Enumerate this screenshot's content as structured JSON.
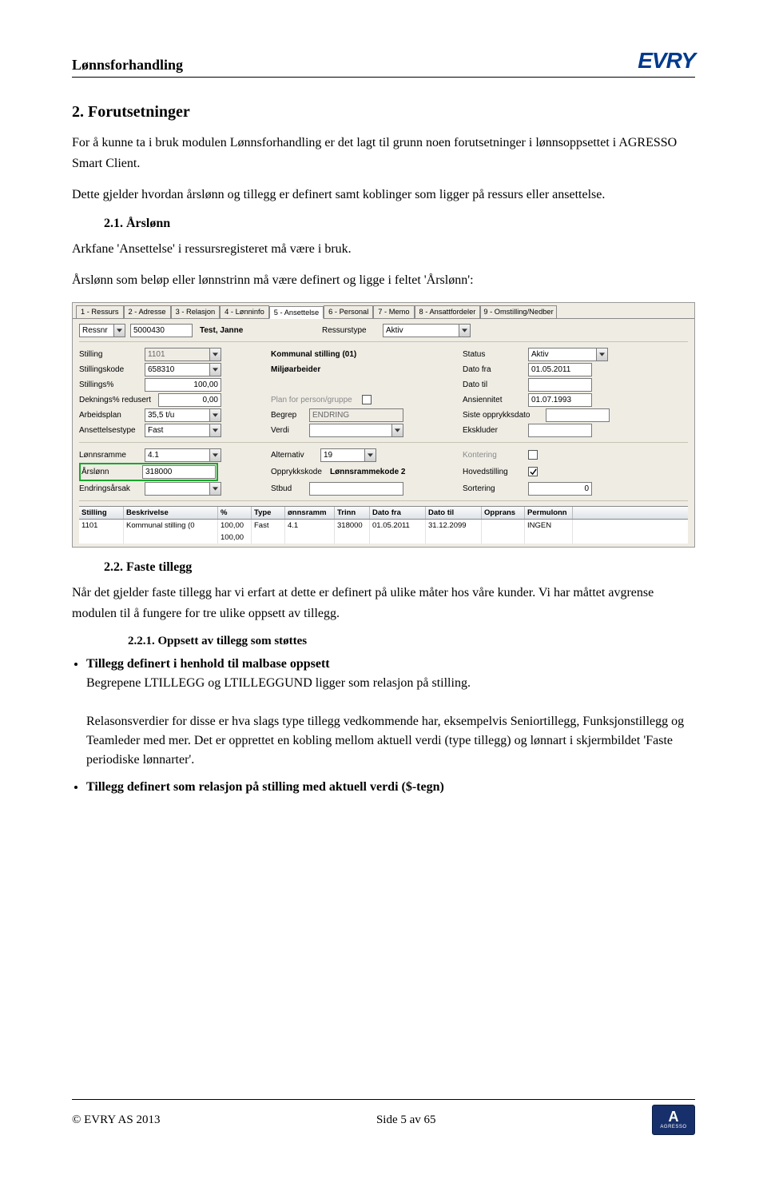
{
  "header": {
    "title": "Lønnsforhandling",
    "logo_text": "EVRY"
  },
  "section2": {
    "heading": "2. Forutsetninger",
    "p1": "For å kunne ta i bruk modulen Lønnsforhandling er det lagt til grunn noen forutsetninger i lønnsoppsettet i AGRESSO Smart Client.",
    "p2": "Dette gjelder hvordan årslønn og tillegg er definert samt koblinger som ligger på ressurs eller ansettelse."
  },
  "s21": {
    "heading": "2.1. Årslønn",
    "p1": "Arkfane 'Ansettelse' i ressursregisteret må være i bruk.",
    "p2": "Årslønn som beløp eller lønnstrinn må være definert og ligge i feltet 'Årslønn':"
  },
  "shot": {
    "tabs": [
      "1 - Ressurs",
      "2 - Adresse",
      "3 - Relasjon",
      "4 - Lønninfo",
      "5 - Ansettelse",
      "6 - Personal",
      "7 - Memo",
      "8 - Ansattfordeler",
      "9 - Omstilling/Nedber"
    ],
    "active_tab_index": 4,
    "row0": {
      "ressnr_label": "Ressnr",
      "ressnr": "5000430",
      "name": "Test, Janne",
      "ressurstype_label": "Ressurstype",
      "ressurstype": "Aktiv"
    },
    "labels_left": {
      "stilling": "Stilling",
      "stillingskode": "Stillingskode",
      "stillingspct": "Stillings%",
      "deknings": "Deknings% redusert",
      "arbeidsplan": "Arbeidsplan",
      "ansettelsestype": "Ansettelsestype",
      "lonnsramme": "Lønnsramme",
      "arslonn": "Årslønn",
      "endringsarsak": "Endringsårsak"
    },
    "labels_mid": {
      "kommunal": "Kommunal stilling (01)",
      "miljo": "Miljøarbeider",
      "plan": "Plan for person/gruppe",
      "begrep": "Begrep",
      "endring": "ENDRING",
      "verdi": "Verdi",
      "alternativ": "Alternativ",
      "opprykkskode": "Opprykkskode",
      "lonnsrammekode": "Lønnsrammekode 2",
      "stbud": "Stbud"
    },
    "labels_right": {
      "status": "Status",
      "datofra": "Dato fra",
      "datotil": "Dato til",
      "ansiennitet": "Ansiennitet",
      "sisteopprykk": "Siste opprykksdato",
      "ekskluder": "Ekskluder",
      "kontering": "Kontering",
      "hovedstilling": "Hovedstilling",
      "sortering": "Sortering"
    },
    "values": {
      "stilling": "1101",
      "stillingskode": "658310",
      "stillingspct": "100,00",
      "deknings": "0,00",
      "arbeidsplan": "35,5 t/u",
      "ansettelsestype": "Fast",
      "lonnsramme": "4.1",
      "arslonn": "318000",
      "endringsarsak": "",
      "alternativ": "19",
      "stbud": "",
      "status": "Aktiv",
      "datofra": "01.05.2011",
      "datotil": "",
      "ansiennitet": "01.07.1993",
      "sisteopprykk": "",
      "ekskluder": "",
      "kontering_checked": false,
      "hovedstilling_checked": true,
      "sortering": "0"
    },
    "table": {
      "headers": [
        "Stilling",
        "Beskrivelse",
        "%",
        "Type",
        "ønnsramm",
        "Trinn",
        "Dato fra",
        "Dato til",
        "Opprans",
        "Permulonn"
      ],
      "row1": [
        "1101",
        "Kommunal stilling (0",
        "100,00",
        "Fast",
        "4.1",
        "318000",
        "01.05.2011",
        "31.12.2099",
        "",
        "INGEN"
      ],
      "row2": [
        "",
        "",
        "100,00",
        "",
        "",
        "",
        "",
        "",
        "",
        ""
      ]
    }
  },
  "s22": {
    "heading": "2.2. Faste tillegg",
    "p1": "Når det gjelder faste tillegg har vi erfart at dette er definert på ulike måter hos våre kunder. Vi har måttet avgrense modulen til å fungere for tre ulike oppsett av tillegg."
  },
  "s221": {
    "heading": "2.2.1.   Oppsett av tillegg som støttes",
    "b1_title": "Tillegg definert i henhold til malbase oppsett",
    "b1_p1": "Begrepene LTILLEGG og LTILLEGGUND ligger som relasjon på stilling.",
    "b1_p2": "Relasonsverdier for disse er hva slags type tillegg vedkommende har, eksempelvis Seniortillegg, Funksjonstillegg og Teamleder med mer. Det er opprettet en kobling mellom aktuell verdi (type tillegg) og lønnart i skjermbildet 'Faste periodiske lønnarter'.",
    "b2_title": "Tillegg definert som relasjon på stilling med aktuell verdi ($-tegn)"
  },
  "footer": {
    "copyright": "© EVRY AS 2013",
    "page": "Side 5 av 65",
    "badge_text": "AGRESSO"
  }
}
